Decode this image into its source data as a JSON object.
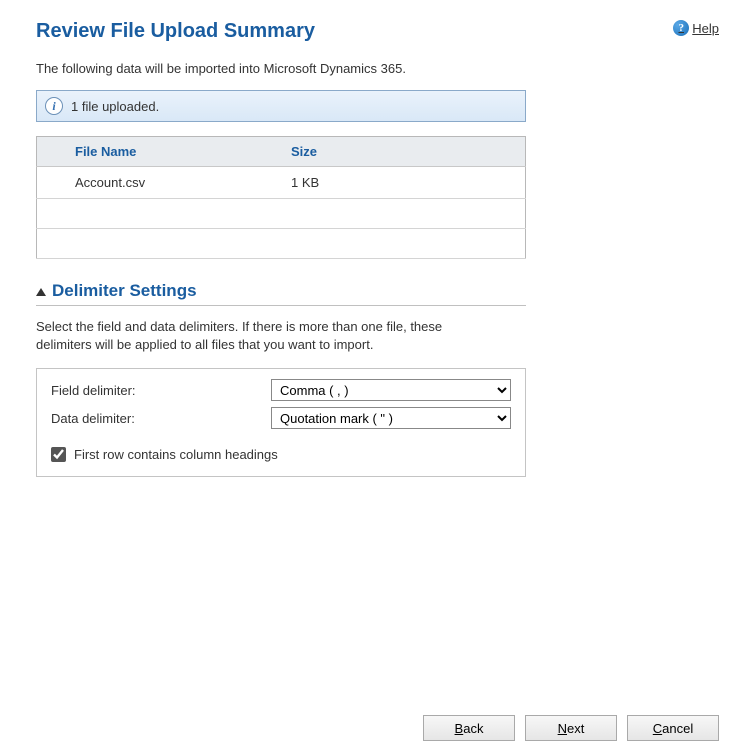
{
  "header": {
    "title": "Review File Upload Summary",
    "help_label": "Help"
  },
  "intro": "The following data will be imported into Microsoft Dynamics 365.",
  "banner": {
    "text": "1 file uploaded."
  },
  "file_table": {
    "columns": {
      "name": "File Name",
      "size": "Size"
    },
    "rows": [
      {
        "name": "Account.csv",
        "size": "1 KB"
      }
    ]
  },
  "delimiter_section": {
    "title": "Delimiter Settings",
    "description": "Select the field and data delimiters. If there is more than one file, these delimiters will be applied to all files that you want to import.",
    "field_label": "Field delimiter:",
    "data_label": "Data delimiter:",
    "field_value": "Comma ( , )",
    "data_value": "Quotation mark ( \" )",
    "checkbox_label": "First row contains column headings",
    "checkbox_checked": true
  },
  "buttons": {
    "back": "Back",
    "next": "Next",
    "cancel": "Cancel"
  }
}
